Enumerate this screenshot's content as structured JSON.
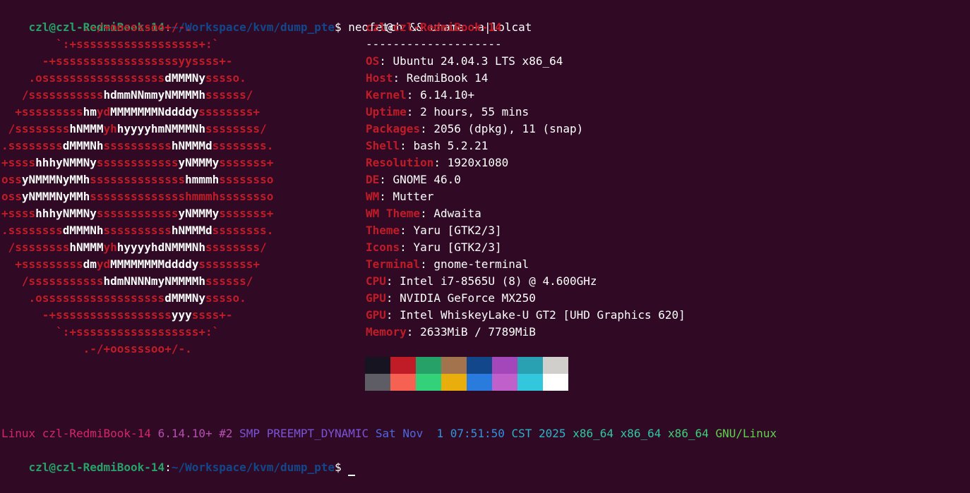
{
  "prompt": {
    "user_host": "czl@czl-RedmiBook-14",
    "colon": ":",
    "path": "~/Workspace/kvm/dump_pte",
    "dollar": "$",
    "command": " neofetch && uname -a|lolcat"
  },
  "logo": [
    [
      [
        "r",
        "            .-/+oossssoo+/-."
      ]
    ],
    [
      [
        "r",
        "        `:+ssssssssssssssssss+:`"
      ]
    ],
    [
      [
        "r",
        "      -+ssssssssssssssssssyyssss+-"
      ]
    ],
    [
      [
        "r",
        "    .ossssssssssssssssss"
      ],
      [
        "w",
        "dMMMNy"
      ],
      [
        "r",
        "sssso."
      ]
    ],
    [
      [
        "r",
        "   /sssssssssss"
      ],
      [
        "w",
        "hdmmNNmmyNMMMMh"
      ],
      [
        "r",
        "ssssss/"
      ]
    ],
    [
      [
        "r",
        "  +sssssssss"
      ],
      [
        "w",
        "hm"
      ],
      [
        "r",
        "yd"
      ],
      [
        "w",
        "MMMMMMMNddddy"
      ],
      [
        "r",
        "ssssssss+"
      ]
    ],
    [
      [
        "r",
        " /ssssssss"
      ],
      [
        "w",
        "hNMMM"
      ],
      [
        "r",
        "yh"
      ],
      [
        "w",
        "hyyyyhmNMMMNh"
      ],
      [
        "r",
        "ssssssss/"
      ]
    ],
    [
      [
        "r",
        ".ssssssss"
      ],
      [
        "w",
        "dMMMNh"
      ],
      [
        "r",
        "ssssssssss"
      ],
      [
        "w",
        "hNMMMd"
      ],
      [
        "r",
        "ssssssss."
      ]
    ],
    [
      [
        "r",
        "+ssss"
      ],
      [
        "w",
        "hhhyNMMNy"
      ],
      [
        "r",
        "ssssssssssss"
      ],
      [
        "w",
        "yNMMMy"
      ],
      [
        "r",
        "sssssss+"
      ]
    ],
    [
      [
        "r",
        "oss"
      ],
      [
        "w",
        "yNMMMNyMMh"
      ],
      [
        "r",
        "ssssssssssssss"
      ],
      [
        "w",
        "hmmmh"
      ],
      [
        "r",
        "ssssssso"
      ]
    ],
    [
      [
        "r",
        "oss"
      ],
      [
        "w",
        "yNMMMNyMMh"
      ],
      [
        "r",
        "sssssssssssssshmmmhssssssso"
      ]
    ],
    [
      [
        "r",
        "+ssss"
      ],
      [
        "w",
        "hhhyNMMNy"
      ],
      [
        "r",
        "ssssssssssss"
      ],
      [
        "w",
        "yNMMMy"
      ],
      [
        "r",
        "sssssss+"
      ]
    ],
    [
      [
        "r",
        ".ssssssss"
      ],
      [
        "w",
        "dMMMNh"
      ],
      [
        "r",
        "ssssssssss"
      ],
      [
        "w",
        "hNMMMd"
      ],
      [
        "r",
        "ssssssss."
      ]
    ],
    [
      [
        "r",
        " /ssssssss"
      ],
      [
        "w",
        "hNMMM"
      ],
      [
        "r",
        "yh"
      ],
      [
        "w",
        "hyyyyhdNMMMNh"
      ],
      [
        "r",
        "ssssssss/"
      ]
    ],
    [
      [
        "r",
        "  +sssssssss"
      ],
      [
        "w",
        "dm"
      ],
      [
        "r",
        "yd"
      ],
      [
        "w",
        "MMMMMMMMddddy"
      ],
      [
        "r",
        "ssssssss+"
      ]
    ],
    [
      [
        "r",
        "   /sssssssssss"
      ],
      [
        "w",
        "hdmNNNNmyNMMMMh"
      ],
      [
        "r",
        "ssssss/"
      ]
    ],
    [
      [
        "r",
        "    .ossssssssssssssssss"
      ],
      [
        "w",
        "dMMMNy"
      ],
      [
        "r",
        "sssso."
      ]
    ],
    [
      [
        "r",
        "      -+sssssssssssssssss"
      ],
      [
        "w",
        "yyy"
      ],
      [
        "r",
        "ssss+-"
      ]
    ],
    [
      [
        "r",
        "        `:+ssssssssssssssssss+:`"
      ]
    ],
    [
      [
        "r",
        "            .-/+oossssoo+/-."
      ]
    ]
  ],
  "info": {
    "header_user": "czl",
    "header_at": "@",
    "header_host": "czl-RedmiBook-14",
    "separator": "--------------------",
    "rows": [
      {
        "key": "OS",
        "value": "Ubuntu 24.04.3 LTS x86_64"
      },
      {
        "key": "Host",
        "value": "RedmiBook 14"
      },
      {
        "key": "Kernel",
        "value": "6.14.10+"
      },
      {
        "key": "Uptime",
        "value": "2 hours, 55 mins"
      },
      {
        "key": "Packages",
        "value": "2056 (dpkg), 11 (snap)"
      },
      {
        "key": "Shell",
        "value": "bash 5.2.21"
      },
      {
        "key": "Resolution",
        "value": "1920x1080"
      },
      {
        "key": "DE",
        "value": "GNOME 46.0"
      },
      {
        "key": "WM",
        "value": "Mutter"
      },
      {
        "key": "WM Theme",
        "value": "Adwaita"
      },
      {
        "key": "Theme",
        "value": "Yaru [GTK2/3]"
      },
      {
        "key": "Icons",
        "value": "Yaru [GTK2/3]"
      },
      {
        "key": "Terminal",
        "value": "gnome-terminal"
      },
      {
        "key": "CPU",
        "value": "Intel i7-8565U (8) @ 4.600GHz"
      },
      {
        "key": "GPU",
        "value": "NVIDIA GeForce MX250"
      },
      {
        "key": "GPU",
        "value": "Intel WhiskeyLake-U GT2 [UHD Graphics 620]"
      },
      {
        "key": "Memory",
        "value": "2633MiB / 7789MiB"
      }
    ]
  },
  "palette": [
    "#171421",
    "#c01c28",
    "#26a269",
    "#a2734c",
    "#12488b",
    "#a347ba",
    "#2aa1b3",
    "#d0cfcc",
    "#5e5c64",
    "#f66151",
    "#33d17a",
    "#e9ad0c",
    "#2a7bde",
    "#c061cb",
    "#33c7de",
    "#ffffff"
  ],
  "uname": {
    "segments": [
      {
        "text": "Linux czl-RedmiBook-14 ",
        "color": "#d6256b"
      },
      {
        "text": "6.14.10+ #2 ",
        "color": "#b54fb0"
      },
      {
        "text": "SMP PREEMPT_DYNAMIC ",
        "color": "#7a53d8"
      },
      {
        "text": "Sat Nov  ",
        "color": "#4d68e0"
      },
      {
        "text": "1 07:51:50 ",
        "color": "#2f93e0"
      },
      {
        "text": "CST 2025 ",
        "color": "#2db3c9"
      },
      {
        "text": "x86_64 x86_64 ",
        "color": "#2fc7a4"
      },
      {
        "text": "x86_64 ",
        "color": "#3dcf79"
      },
      {
        "text": "GNU/Linux",
        "color": "#5fd24e"
      }
    ]
  }
}
